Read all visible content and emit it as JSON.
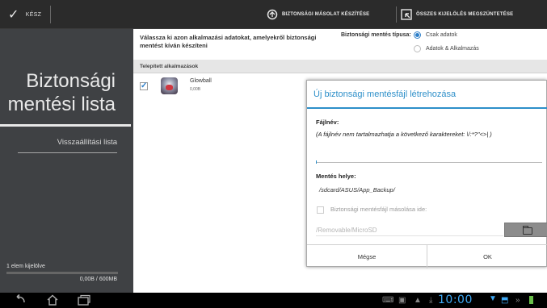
{
  "topbar": {
    "done_label": "KÉSZ",
    "create_backup_label": "BIZTONSÁGI MÁSOLAT KÉSZÍTÉSE",
    "deselect_all_label": "ÖSSZES KIJELÖLÉS MEGSZÜNTETÉSE"
  },
  "sidebar": {
    "title_line1": "Biztonsági",
    "title_line2": "mentési lista",
    "restore_list": "Visszaállítási lista",
    "selected_count": "1 elem kijelölve",
    "storage": "0,00B / 600MB",
    "storage_fraction": 0.0
  },
  "main": {
    "instruction": "Válassza ki azon alkalmazási adatokat, amelyekről biztonsági mentést kíván készíteni",
    "backup_type_label": "Biztonsági mentés típusa:",
    "backup_types": [
      {
        "label": "Csak adatok",
        "selected": true
      },
      {
        "label": "Adatok & Alkalmazás",
        "selected": false
      }
    ],
    "list_header": "Telepített alkalmazások",
    "apps": [
      {
        "name": "Glowball",
        "size": "0,00B",
        "checked": true
      }
    ]
  },
  "dialog": {
    "title": "Új biztonsági mentésfájl létrehozása",
    "filename_label": "Fájlnév:",
    "filename_hint": "(A fájlnév nem tartalmazhatja a következő karaktereket: \\/:*?\"<>| )",
    "filename_value": "",
    "location_label": "Mentés helye:",
    "location_value": "/sdcard/ASUS/App_Backup/",
    "copy_label": "Biztonsági mentésfájl másolása ide:",
    "copy_placeholder": "/Removable/MicroSD",
    "cancel_label": "Mégse",
    "ok_label": "OK"
  },
  "statusbar": {
    "time": "10:00"
  },
  "colors": {
    "accent": "#2d8fc9",
    "sidebar_bg": "#3f4144",
    "topbar_bg": "#2b2b2b"
  }
}
